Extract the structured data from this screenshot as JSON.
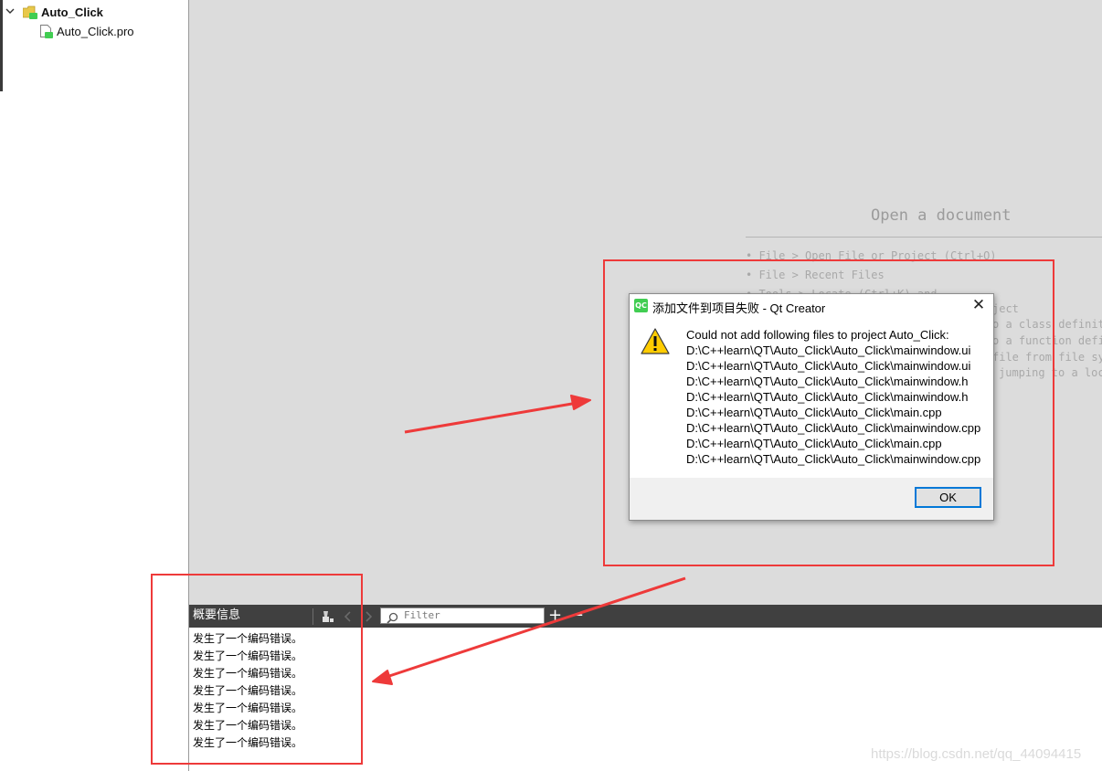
{
  "project_tree": {
    "project_name": "Auto_Click",
    "file_name": "Auto_Click.pro"
  },
  "editor": {
    "open_document_title": "Open a document",
    "hints": [
      "• File > Open File or Project (Ctrl+O)",
      "• File > Recent Files",
      "• Tools > Locate (Ctrl+K) and",
      "ject",
      "o a class definiti",
      "o a function defi",
      "file from file sys",
      "jumping to a loc"
    ]
  },
  "output_pane": {
    "title": "概要信息",
    "filter_placeholder": "Filter",
    "add_label": "+",
    "remove_label": "−",
    "messages": [
      "发生了一个编码错误。",
      "发生了一个编码错误。",
      "发生了一个编码错误。",
      "发生了一个编码错误。",
      "发生了一个编码错误。",
      "发生了一个编码错误。",
      "发生了一个编码错误。"
    ]
  },
  "dialog": {
    "title": "添加文件到项目失败 - Qt Creator",
    "app_icon": "QC",
    "message": "Could not add following files to project Auto_Click:",
    "files": [
      "D:\\C++learn\\QT\\Auto_Click\\Auto_Click\\mainwindow.ui",
      "D:\\C++learn\\QT\\Auto_Click\\Auto_Click\\mainwindow.ui",
      "D:\\C++learn\\QT\\Auto_Click\\Auto_Click\\mainwindow.h",
      "D:\\C++learn\\QT\\Auto_Click\\Auto_Click\\mainwindow.h",
      "D:\\C++learn\\QT\\Auto_Click\\Auto_Click\\main.cpp",
      "D:\\C++learn\\QT\\Auto_Click\\Auto_Click\\mainwindow.cpp",
      "D:\\C++learn\\QT\\Auto_Click\\Auto_Click\\main.cpp",
      "D:\\C++learn\\QT\\Auto_Click\\Auto_Click\\mainwindow.cpp"
    ],
    "ok_label": "OK",
    "close_label": "✕"
  },
  "watermark": "https://blog.csdn.net/qq_44094415",
  "colors": {
    "annotation_red": "#ee3a3a",
    "qt_green": "#41cd52",
    "button_focus_blue": "#0078d7",
    "pane_toolbar": "#404040"
  }
}
